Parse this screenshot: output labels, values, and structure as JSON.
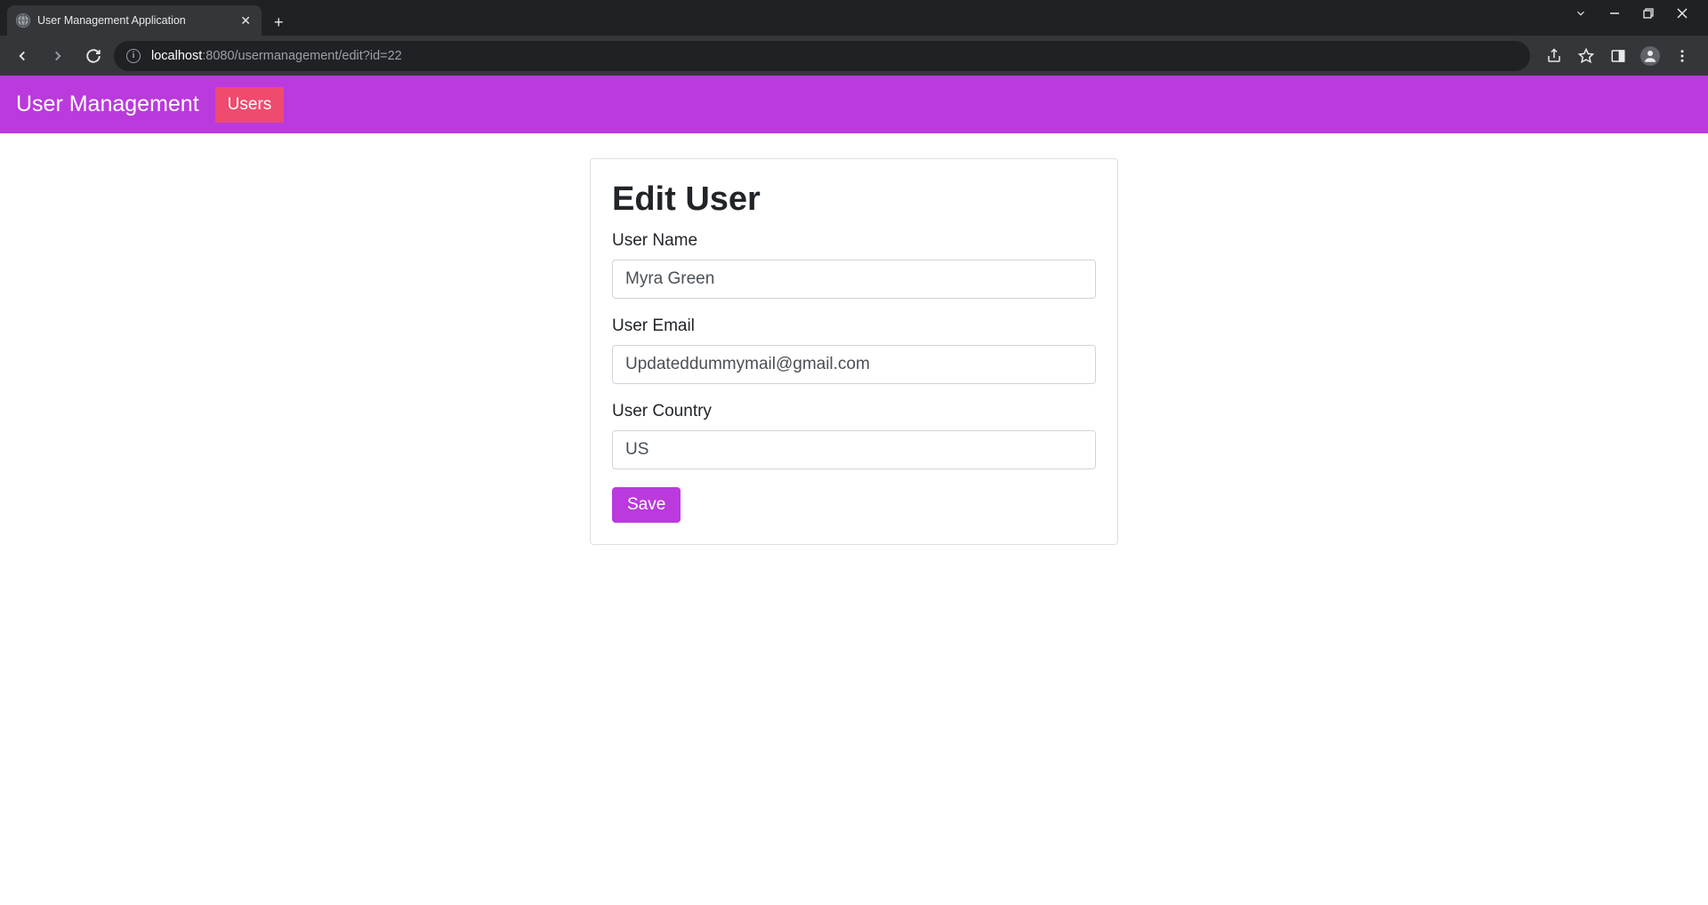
{
  "browser": {
    "tab_title": "User Management Application",
    "url_host": "localhost",
    "url_port_path": ":8080/usermanagement/edit?id=22"
  },
  "navbar": {
    "brand": "User Management",
    "users_link": "Users"
  },
  "form": {
    "heading": "Edit User",
    "name_label": "User Name",
    "name_value": "Myra Green",
    "email_label": "User Email",
    "email_value": "Updateddummymail@gmail.com",
    "country_label": "User Country",
    "country_value": "US",
    "save_label": "Save"
  }
}
